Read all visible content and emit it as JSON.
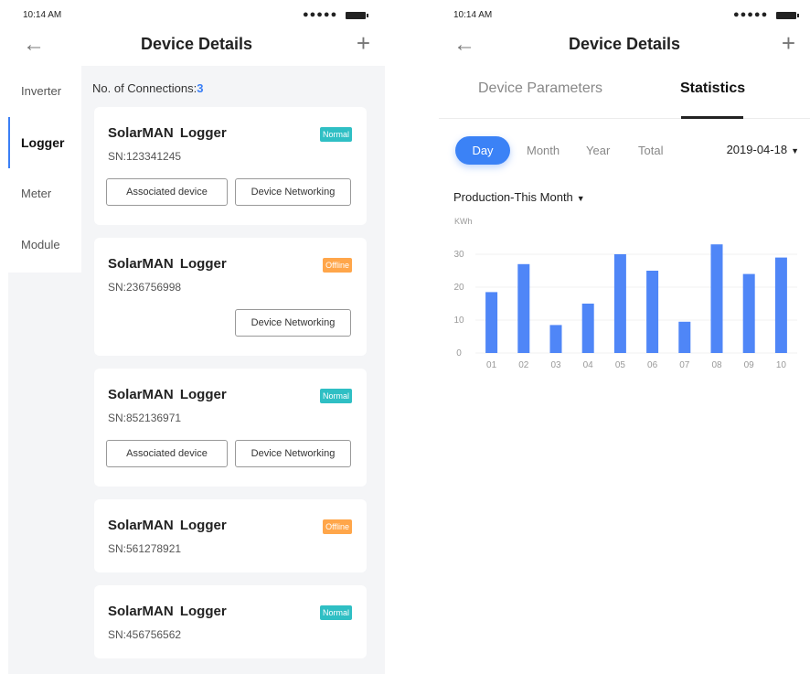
{
  "status": {
    "time": "10:14 AM",
    "signal": "●●●●●"
  },
  "nav": {
    "back_icon": "←",
    "title": "Device Details",
    "plus_icon": "+"
  },
  "sidebar": {
    "items": [
      {
        "label": "Inverter"
      },
      {
        "label": "Logger"
      },
      {
        "label": "Meter"
      },
      {
        "label": "Module"
      }
    ]
  },
  "connections": {
    "label": "No. of Connections:",
    "count": "3"
  },
  "buttons": {
    "associated": "Associated device",
    "networking": "Device Networking"
  },
  "devices": [
    {
      "name": "SolarMAN Logger",
      "sn": "SN:123341245",
      "status": "Normal"
    },
    {
      "name": "SolarMAN Logger",
      "sn": "SN:236756998",
      "status": "Offline"
    },
    {
      "name": "SolarMAN Logger",
      "sn": "SN:852136971",
      "status": "Normal"
    },
    {
      "name": "SolarMAN Logger",
      "sn": "SN:561278921",
      "status": "Offline"
    },
    {
      "name": "SolarMAN Logger",
      "sn": "SN:456756562",
      "status": "Normal"
    }
  ],
  "tabs": {
    "parameters": "Device Parameters",
    "statistics": "Statistics"
  },
  "period": {
    "day": "Day",
    "month": "Month",
    "year": "Year",
    "total": "Total"
  },
  "date": {
    "value": "2019-04-18",
    "caret": "▼"
  },
  "production": {
    "label": "Production-This Month",
    "caret": "▼"
  },
  "colors": {
    "accent": "#3b82f6",
    "normal": "#2fbfc4",
    "offline": "#ffa64a"
  },
  "chart_data": {
    "type": "bar",
    "ylabel": "KWh",
    "ylim": [
      0,
      35
    ],
    "yticks": [
      0,
      10,
      20,
      30
    ],
    "categories": [
      "01",
      "02",
      "03",
      "04",
      "05",
      "06",
      "07",
      "08",
      "09",
      "10"
    ],
    "values": [
      18.5,
      27,
      8.5,
      15,
      30,
      25,
      9.5,
      33,
      24,
      29
    ],
    "grid": true,
    "color": "#4f86f7"
  }
}
